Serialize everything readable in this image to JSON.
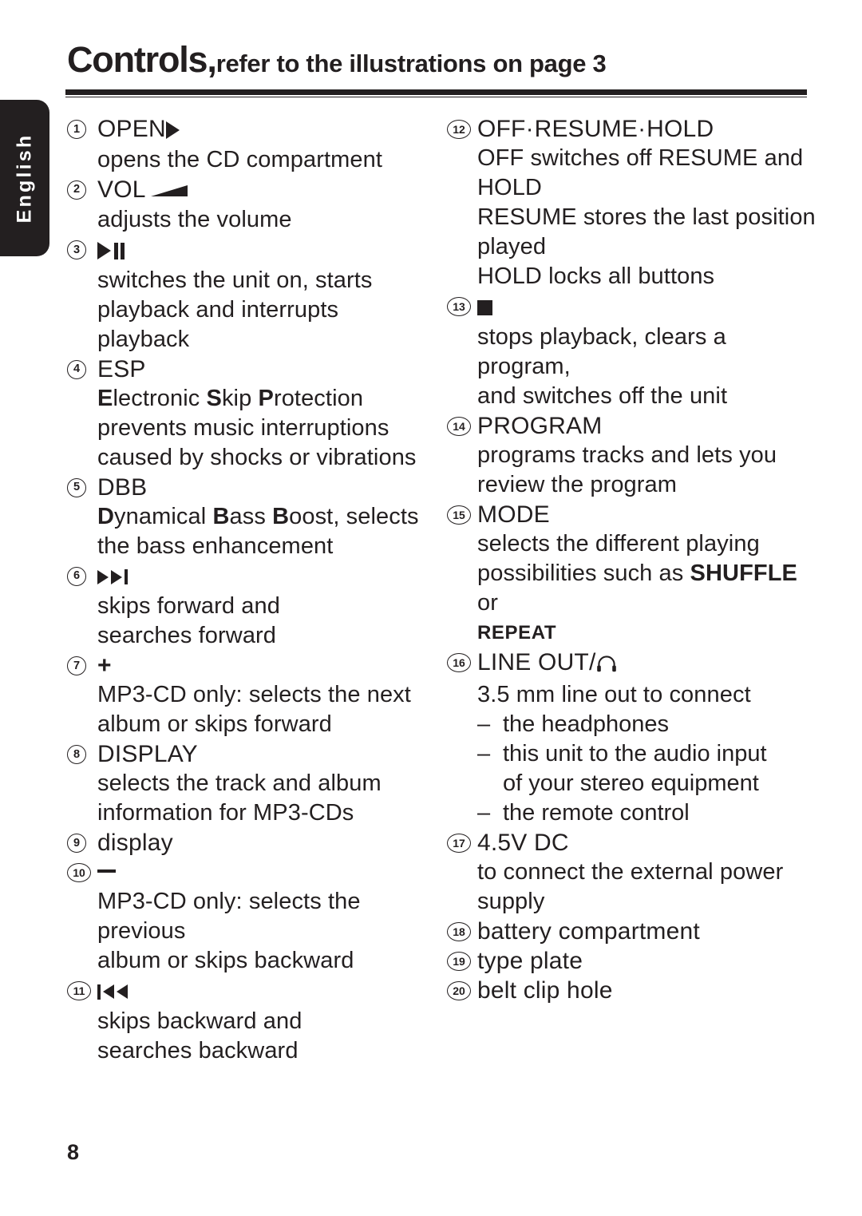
{
  "language_tab": {
    "label": "English"
  },
  "header": {
    "title_main": "Controls,",
    "title_sub": "refer to the illustrations on page 3"
  },
  "footer": {
    "page_number": "8"
  },
  "columns": {
    "left": [
      {
        "num": "1",
        "label": "OPEN",
        "icon": "play-triangle-icon",
        "lines": [
          "opens the CD compartment"
        ]
      },
      {
        "num": "2",
        "label": "VOL",
        "icon": "volume-wedge-icon",
        "lines": [
          "adjusts the volume"
        ]
      },
      {
        "num": "3",
        "label": "",
        "icon": "play-pause-icon",
        "lines": [
          "switches the unit on, starts",
          "playback and interrupts playback"
        ]
      },
      {
        "num": "4",
        "label": "ESP",
        "icon": "",
        "lines": [
          "Electronic Skip Protection",
          "prevents music interruptions",
          "caused by shocks or vibrations"
        ],
        "bold_initials": [
          "E",
          "S",
          "P"
        ]
      },
      {
        "num": "5",
        "label": "DBB",
        "icon": "",
        "lines": [
          "Dynamical Bass Boost, selects",
          "the bass enhancement"
        ],
        "bold_initials": [
          "D",
          "B",
          "B"
        ]
      },
      {
        "num": "6",
        "label": "",
        "icon": "skip-forward-icon",
        "lines": [
          "skips forward and",
          "searches forward"
        ]
      },
      {
        "num": "7",
        "label": "+",
        "icon": "plus-icon",
        "lines": [
          "MP3-CD only: selects the next",
          "album or skips forward"
        ]
      },
      {
        "num": "8",
        "label": "DISPLAY",
        "icon": "",
        "lines": [
          "selects the track and album",
          "information for MP3-CDs"
        ]
      },
      {
        "num": "9",
        "label": "display",
        "icon": "",
        "lines": []
      },
      {
        "num": "10",
        "label": "–",
        "icon": "minus-icon",
        "lines": [
          "MP3-CD only: selects the previous",
          "album or skips backward"
        ]
      },
      {
        "num": "11",
        "label": "",
        "icon": "skip-backward-icon",
        "lines": [
          "skips backward and",
          "searches backward"
        ]
      }
    ],
    "right": [
      {
        "num": "12",
        "label": "OFF·RESUME·HOLD",
        "icon": "",
        "lines": [
          "OFF switches off RESUME and",
          "HOLD",
          "RESUME stores the last position",
          "played",
          "HOLD locks all buttons"
        ]
      },
      {
        "num": "13",
        "label": "",
        "icon": "stop-square-icon",
        "lines": [
          "stops playback, clears a program,",
          "and switches off the unit"
        ]
      },
      {
        "num": "14",
        "label": "PROGRAM",
        "icon": "",
        "lines": [
          "programs tracks and lets you",
          "review the program"
        ]
      },
      {
        "num": "15",
        "label": "MODE",
        "icon": "",
        "lines": [
          "selects the different playing",
          "possibilities such as SHUFFLE or",
          "REPEAT"
        ],
        "bold_words": [
          "SHUFFLE",
          "REPEAT"
        ]
      },
      {
        "num": "16",
        "label": "LINE OUT/",
        "icon": "headphones-icon",
        "lines": [
          "3.5 mm line out to connect"
        ],
        "dash_lines": [
          {
            "dash": "–",
            "text": "the headphones",
            "continuation": false
          },
          {
            "dash": "–",
            "text": "this unit to the audio input",
            "continuation": false
          },
          {
            "dash": "",
            "text": "of your stereo equipment",
            "continuation": true
          },
          {
            "dash": "–",
            "text": "the remote control",
            "continuation": false
          }
        ]
      },
      {
        "num": "17",
        "label": "4.5V DC",
        "icon": "",
        "lines": [
          "to connect the external power",
          "supply"
        ]
      },
      {
        "num": "18",
        "label": "battery compartment",
        "icon": "",
        "lines": []
      },
      {
        "num": "19",
        "label": "type plate",
        "icon": "",
        "lines": []
      },
      {
        "num": "20",
        "label": "belt clip hole",
        "icon": "",
        "lines": []
      }
    ]
  },
  "colors": {
    "ink": "#231f20",
    "paper": "#ffffff",
    "tab_bg": "#231f20",
    "tab_text": "#ffffff"
  }
}
